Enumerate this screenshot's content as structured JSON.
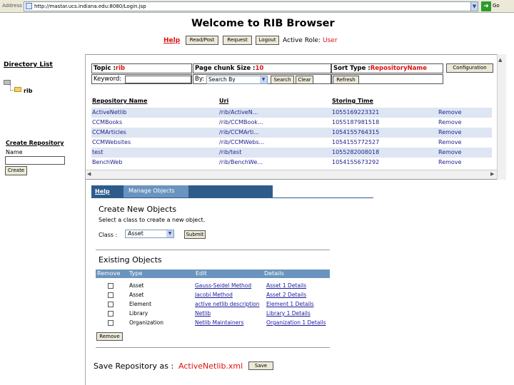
{
  "browser": {
    "address_label": "Address",
    "url": "http://mastar.ucs.indiana.edu:8080/Login.jsp",
    "go_label": "Go",
    "dropdown_glyph": "▼",
    "go_glyph": "➜"
  },
  "header": {
    "title": "Welcome to RIB Browser",
    "help_link": "Help",
    "buttons": {
      "readpost": "Read/Post",
      "request": "Request",
      "logout": "Logout"
    },
    "role_label": "Active Role:",
    "role_value": "User"
  },
  "sidebar": {
    "directory_title": "Directory List",
    "tree_item": "rib",
    "create_title": "Create Repository",
    "name_label": "Name",
    "create_button": "Create"
  },
  "controls": {
    "topic_label": "Topic :",
    "topic_value": "rib",
    "chunk_label": "Page chunk Size :",
    "chunk_value": "10",
    "sort_label": "Sort Type :",
    "sort_value": "RepositoryName",
    "config_button": "Configuration",
    "keyword_label": "Keyword:",
    "by_label": "By:",
    "by_select": "Search By",
    "search_button": "Search",
    "clear_button": "Clear",
    "refresh_button": "Refresh"
  },
  "repo_table": {
    "headers": [
      "Repository Name",
      "Uri",
      "Storing Time"
    ],
    "rows": [
      [
        "ActiveNetlib",
        "/rib/ActiveN...",
        "1055169223321",
        "Remove"
      ],
      [
        "CCMBooks",
        "/rib/CCMBook...",
        "1055187981518",
        "Remove"
      ],
      [
        "CCMArticles",
        "/rib/CCMArti...",
        "1054155764315",
        "Remove"
      ],
      [
        "CCMWebsites",
        "/rib/CCMWebs...",
        "1054155772527",
        "Remove"
      ],
      [
        "test",
        "/rib/test",
        "1055282008018",
        "Remove"
      ],
      [
        "BenchWeb",
        "/rib/BenchWe...",
        "1054155673292",
        "Remove"
      ]
    ]
  },
  "tabs": {
    "help": "Help",
    "manage": "Manage Objects"
  },
  "create_objects": {
    "title": "Create New Objects",
    "description": "Select a class to create a new object.",
    "class_label": "Class :",
    "class_value": "Asset",
    "submit_button": "Submit"
  },
  "existing_objects": {
    "title": "Existing Objects",
    "headers": [
      "Remove",
      "Type",
      "Edit",
      "Details"
    ],
    "rows": [
      {
        "type": "Asset",
        "edit": "Gauss-Seidel Method",
        "details": "Asset 1 Details"
      },
      {
        "type": "Asset",
        "edit": "Jacobi Method",
        "details": "Asset 2 Details"
      },
      {
        "type": "Element",
        "edit": "active netlib description",
        "details": "Element 1 Details"
      },
      {
        "type": "Library",
        "edit": "Netlib",
        "details": "Library 1 Details"
      },
      {
        "type": "Organization",
        "edit": "Netlib Maintainers",
        "details": "Organization 1 Details"
      }
    ],
    "remove_button": "Remove"
  },
  "save": {
    "label": "Save Repository as :",
    "value": "ActiveNetlib.xml",
    "button": "Save"
  }
}
